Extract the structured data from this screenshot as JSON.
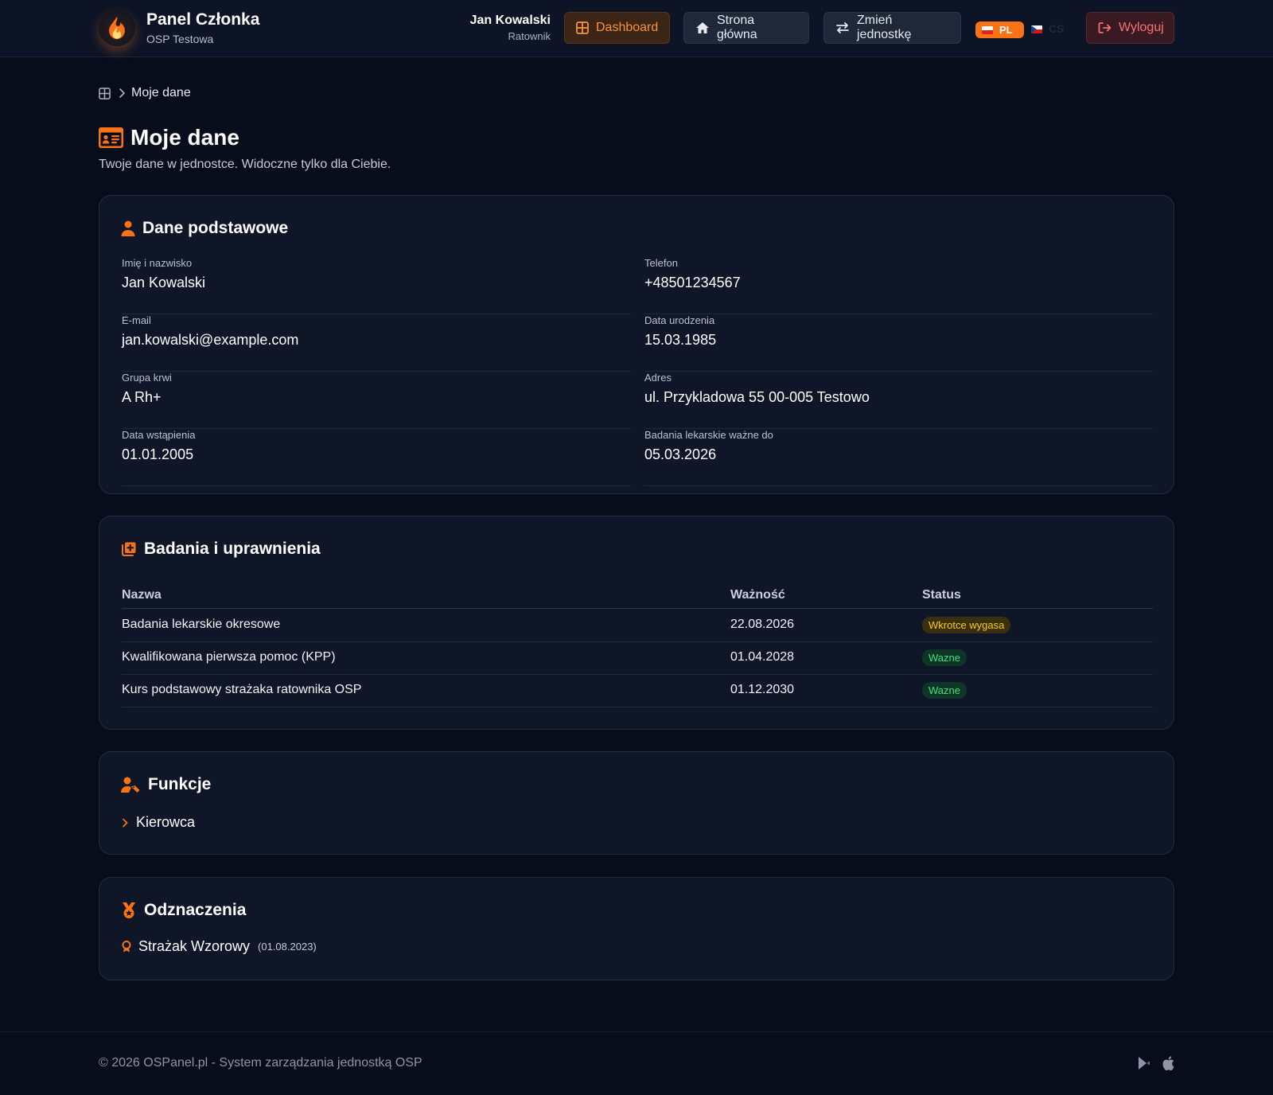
{
  "header": {
    "title": "Panel Członka",
    "subtitle": "OSP Testowa",
    "user_name": "Jan Kowalski",
    "user_role": "Ratownik",
    "nav": {
      "dashboard": "Dashboard",
      "home": "Strona główna",
      "switch_unit": "Zmień jednostkę",
      "logout": "Wyloguj"
    },
    "languages": {
      "active": "PL",
      "other": "CS"
    }
  },
  "breadcrumb": {
    "current": "Moje dane"
  },
  "page": {
    "title": "Moje dane",
    "subtitle": "Twoje dane w jednostce. Widoczne tylko dla Ciebie."
  },
  "basic": {
    "title": "Dane podstawowe",
    "fields": [
      {
        "label": "Imię i nazwisko",
        "value": "Jan Kowalski"
      },
      {
        "label": "Telefon",
        "value": "+48501234567"
      },
      {
        "label": "E-mail",
        "value": "jan.kowalski@example.com"
      },
      {
        "label": "Data urodzenia",
        "value": "15.03.1985"
      },
      {
        "label": "Grupa krwi",
        "value": "A Rh+"
      },
      {
        "label": "Adres",
        "value": "ul. Przykladowa 55 00-005 Testowo"
      },
      {
        "label": "Data wstąpienia",
        "value": "01.01.2005"
      },
      {
        "label": "Badania lekarskie ważne do",
        "value": "05.03.2026"
      }
    ]
  },
  "qualifications": {
    "title": "Badania i uprawnienia",
    "columns": [
      "Nazwa",
      "Ważność",
      "Status"
    ],
    "rows": [
      {
        "name": "Badania lekarskie okresowe",
        "valid": "22.08.2026",
        "status": "Wkrotce wygasa"
      },
      {
        "name": "Kwalifikowana pierwsza pomoc (KPP)",
        "valid": "01.04.2028",
        "status": "Wazne"
      },
      {
        "name": "Kurs podstawowy strażaka ratownika OSP",
        "valid": "01.12.2030",
        "status": "Wazne"
      }
    ]
  },
  "functions": {
    "title": "Funkcje",
    "items": [
      "Kierowca"
    ]
  },
  "awards": {
    "title": "Odznaczenia",
    "items": [
      {
        "name": "Strażak Wzorowy",
        "date": "(01.08.2023)"
      }
    ]
  },
  "footer": {
    "text": "© 2026 OSPanel.pl - System zarządzania jednostką OSP"
  },
  "colors": {
    "accent": "#f97316",
    "background": "#070d1b",
    "card": "#0e1628",
    "warn": "#facc15",
    "ok": "#4ade80",
    "danger": "#f87171"
  }
}
